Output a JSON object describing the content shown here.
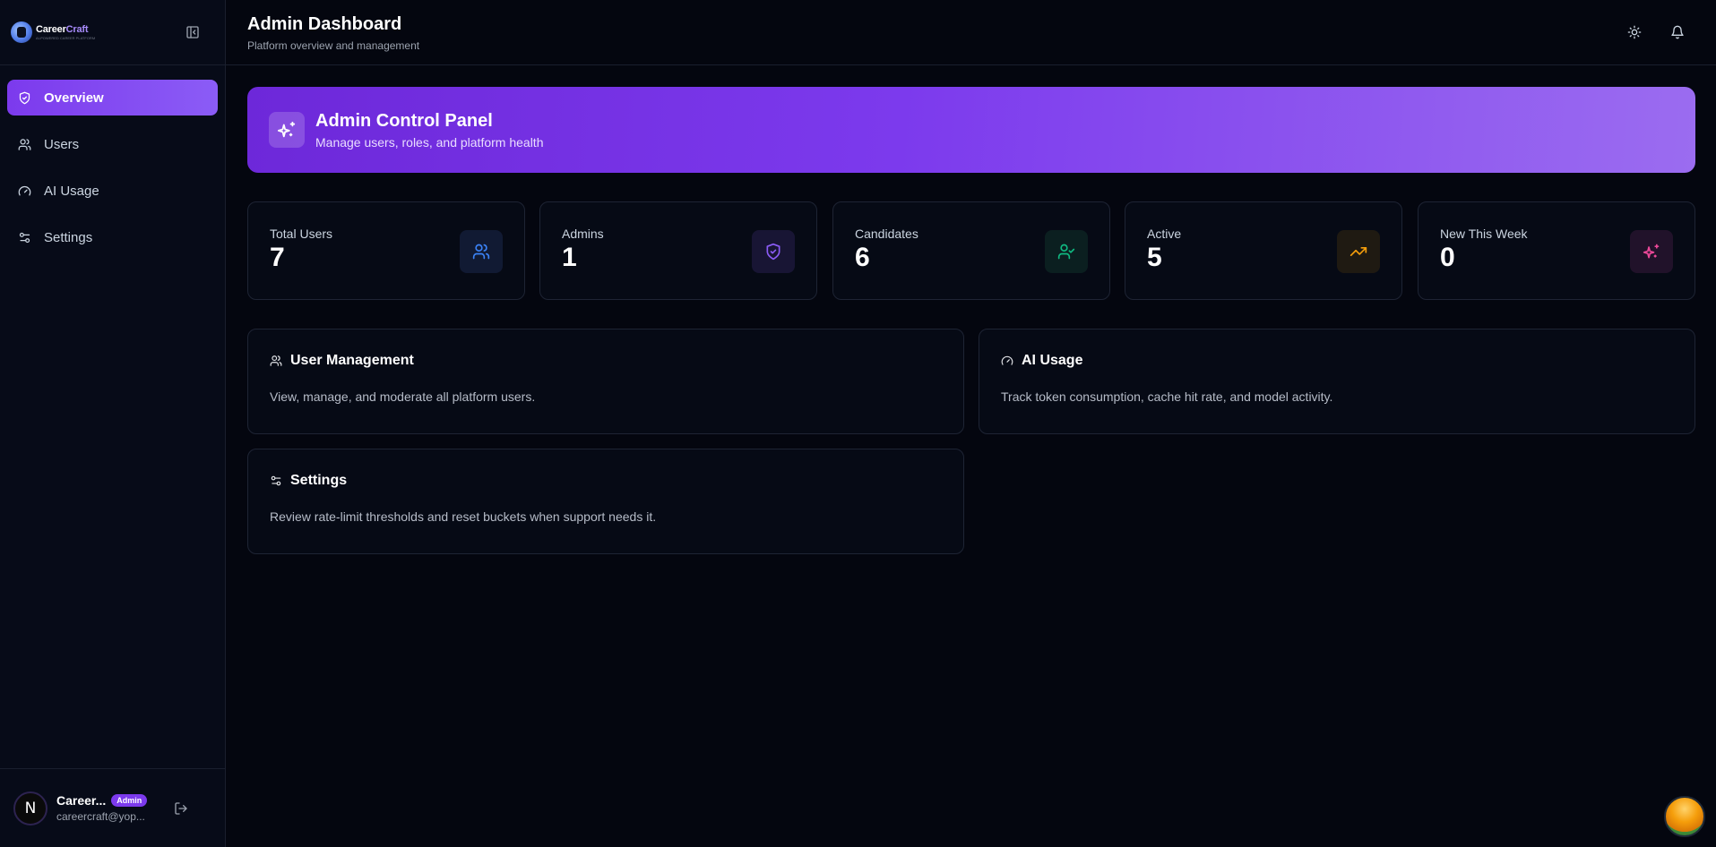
{
  "brand": {
    "name_part1": "Career",
    "name_part2": "Craft",
    "tagline": "AI-POWERED CAREER PLATFORM"
  },
  "sidebar": {
    "items": [
      {
        "label": "Overview",
        "icon": "shield-check-icon",
        "active": true
      },
      {
        "label": "Users",
        "icon": "users-icon"
      },
      {
        "label": "AI Usage",
        "icon": "gauge-icon"
      },
      {
        "label": "Settings",
        "icon": "sliders-icon"
      }
    ],
    "user": {
      "initial": "N",
      "name": "Career...",
      "role": "Admin",
      "email": "careercraft@yop..."
    }
  },
  "header": {
    "title": "Admin Dashboard",
    "subtitle": "Platform overview and management",
    "icons": [
      "sun-icon",
      "bell-icon"
    ]
  },
  "hero": {
    "title": "Admin Control Panel",
    "subtitle": "Manage users, roles, and platform health",
    "icon": "sparkles-icon"
  },
  "stats": [
    {
      "label": "Total Users",
      "value": "7",
      "icon": "users-icon",
      "color": "#3b82f6"
    },
    {
      "label": "Admins",
      "value": "1",
      "icon": "shield-check-icon",
      "color": "#8b5cf6"
    },
    {
      "label": "Candidates",
      "value": "6",
      "icon": "user-check-icon",
      "color": "#10b981"
    },
    {
      "label": "Active",
      "value": "5",
      "icon": "trending-up-icon",
      "color": "#f59e0b"
    },
    {
      "label": "New This Week",
      "value": "0",
      "icon": "sparkles-icon",
      "color": "#ec4899"
    }
  ],
  "panels": [
    {
      "title": "User Management",
      "description": "View, manage, and moderate all platform users.",
      "icon": "users-icon"
    },
    {
      "title": "AI Usage",
      "description": "Track token consumption, cache hit rate, and model activity.",
      "icon": "gauge-icon"
    },
    {
      "title": "Settings",
      "description": "Review rate-limit thresholds and reset buckets when support needs it.",
      "icon": "sliders-icon"
    }
  ],
  "colors": {
    "accent": "#7c3aed",
    "background": "#04060f",
    "sidebar": "#070b18"
  }
}
